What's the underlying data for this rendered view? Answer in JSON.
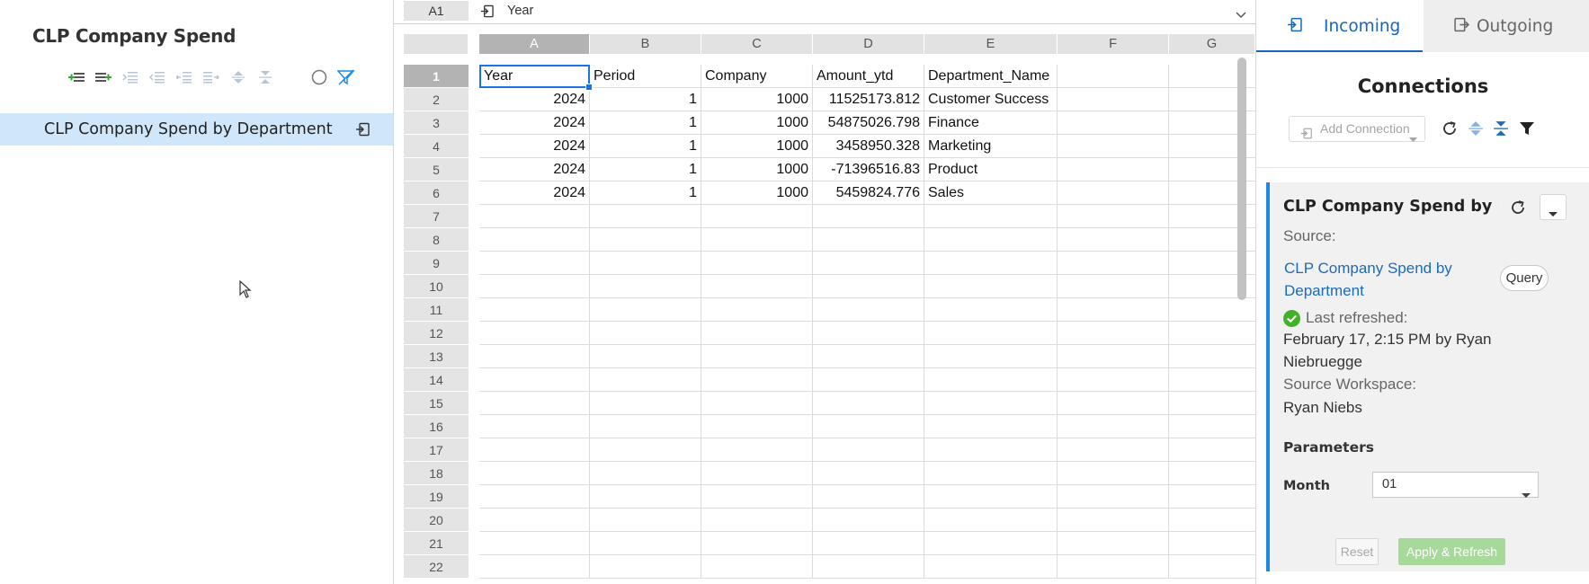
{
  "outline": {
    "title": "CLP Company Spend",
    "tools": [
      "add-row-icon",
      "add-child-row-icon",
      "indent-icon",
      "outdent-icon",
      "move-left-icon",
      "move-right-icon",
      "expand-icon",
      "collapse-icon",
      "circle-icon",
      "filter-off-icon"
    ],
    "selected_item": "CLP Company Spend by Department"
  },
  "formula_bar": {
    "name_box": "A1",
    "formula": "Year"
  },
  "grid": {
    "columns": [
      "A",
      "B",
      "C",
      "D",
      "E",
      "F",
      "G"
    ],
    "rows": [
      "1",
      "2",
      "3",
      "4",
      "5",
      "6",
      "7",
      "8",
      "9",
      "10",
      "11",
      "12",
      "13",
      "14",
      "15",
      "16",
      "17",
      "18",
      "19",
      "20",
      "21",
      "22"
    ],
    "cells": [
      [
        "Year",
        "Period",
        "Company",
        "Amount_ytd",
        "Department_Name"
      ],
      [
        "2024",
        "1",
        "1000",
        "11525173.812",
        "Customer Success"
      ],
      [
        "2024",
        "1",
        "1000",
        "54875026.798",
        "Finance"
      ],
      [
        "2024",
        "1",
        "1000",
        "3458950.328",
        "Marketing"
      ],
      [
        "2024",
        "1",
        "1000",
        "-71396516.83",
        "Product"
      ],
      [
        "2024",
        "1",
        "1000",
        "5459824.776",
        "Sales"
      ]
    ]
  },
  "connections_panel": {
    "tabs": {
      "incoming": "Incoming",
      "outgoing": "Outgoing"
    },
    "heading": "Connections",
    "add_connection": "Add Connection",
    "card": {
      "title": "CLP Company Spend by Department",
      "source_label": "Source:",
      "source_link": "CLP Company Spend by Department",
      "query_button": "Query",
      "last_refreshed_label": "Last refreshed:",
      "last_refreshed_value": "February 17, 2:15 PM by Ryan Niebruegge",
      "workspace_label": "Source Workspace:",
      "workspace_value": "Ryan Niebs",
      "parameters_label": "Parameters",
      "month_label": "Month",
      "month_value": "01",
      "reset_button": "Reset",
      "apply_button": "Apply & Refresh"
    },
    "colors": {
      "accent": "#1565c0",
      "card_border": "#1e88e5",
      "success": "#43b02a",
      "apply_disabled": "#a6d99a"
    }
  }
}
